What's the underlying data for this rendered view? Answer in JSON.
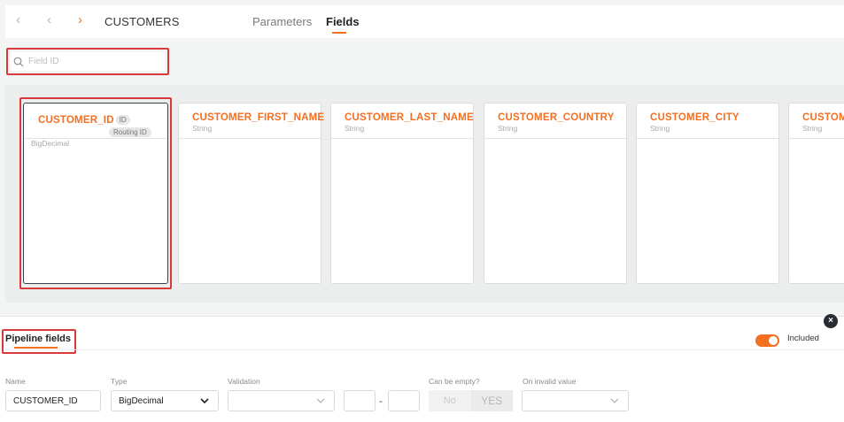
{
  "topbar": {
    "nav_back_1": "‹",
    "nav_back_2": "‹",
    "nav_forward": "›",
    "title": "CUSTOMERS",
    "tabs": [
      {
        "label": "Parameters"
      },
      {
        "label": "Fields"
      }
    ],
    "active_tab": "Fields"
  },
  "search": {
    "placeholder": "Field ID",
    "value": ""
  },
  "fields": [
    {
      "name": "CUSTOMER_ID",
      "badge": "ID",
      "routing_badge": "Routing ID",
      "type": "BigDecimal"
    },
    {
      "name": "CUSTOMER_FIRST_NAME",
      "type": "String"
    },
    {
      "name": "CUSTOMER_LAST_NAME",
      "type": "String"
    },
    {
      "name": "CUSTOMER_COUNTRY",
      "type": "String"
    },
    {
      "name": "CUSTOMER_CITY",
      "type": "String"
    },
    {
      "name": "CUSTOME",
      "type": "String"
    }
  ],
  "pipeline": {
    "title": "Pipeline fields",
    "included_label": "Included",
    "included": true,
    "close_label": "×",
    "form": {
      "name_label": "Name",
      "name_value": "CUSTOMER_ID",
      "type_label": "Type",
      "type_value": "BigDecimal",
      "validation_label": "Validation",
      "validation_value": "",
      "range_separator": "-",
      "can_be_empty_label": "Can be empty?",
      "can_be_empty_options": [
        "No",
        "YES"
      ],
      "can_be_empty_selected": "YES",
      "on_invalid_label": "On invalid value",
      "on_invalid_value": ""
    }
  },
  "colors": {
    "accent": "#f36f21",
    "highlight_border": "#d9393b",
    "selected_border": "#3a3f4a"
  }
}
